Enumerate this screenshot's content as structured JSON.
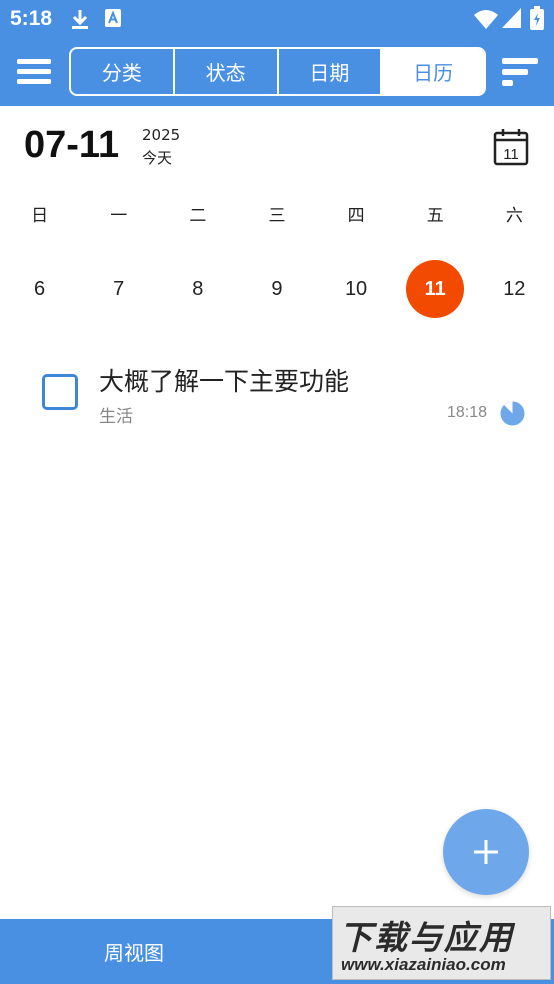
{
  "status_bar": {
    "time": "5:18",
    "left_icons": [
      "download-icon",
      "font-a-icon"
    ],
    "right_icons": [
      "wifi-icon",
      "signal-icon",
      "battery-icon"
    ]
  },
  "app_bar": {
    "menu_icon": "menu-icon",
    "sort_icon": "sort-icon",
    "tabs": [
      {
        "label": "分类",
        "active": false
      },
      {
        "label": "状态",
        "active": false
      },
      {
        "label": "日期",
        "active": false
      },
      {
        "label": "日历",
        "active": true
      }
    ]
  },
  "date_header": {
    "date": "07-11",
    "year": "2025",
    "relative": "今天",
    "calendar_icon_day": "11"
  },
  "calendar": {
    "weekdays": [
      "日",
      "一",
      "二",
      "三",
      "四",
      "五",
      "六"
    ],
    "days": [
      "6",
      "7",
      "8",
      "9",
      "10",
      "11",
      "12"
    ],
    "selected_day": "11"
  },
  "tasks": [
    {
      "title": "大概了解一下主要功能",
      "category": "生活",
      "time": "18:18",
      "checked": false
    }
  ],
  "fab": {
    "icon": "plus-icon"
  },
  "bottom_bar": {
    "tab_label": "周视图"
  },
  "watermark": {
    "title": "下载与应用",
    "url": "www.xiazainiao.com"
  },
  "colors": {
    "primary": "#4a90e2",
    "selected_day": "#f24a00",
    "fab": "#6fa8ea",
    "checkbox": "#3e86d8"
  }
}
